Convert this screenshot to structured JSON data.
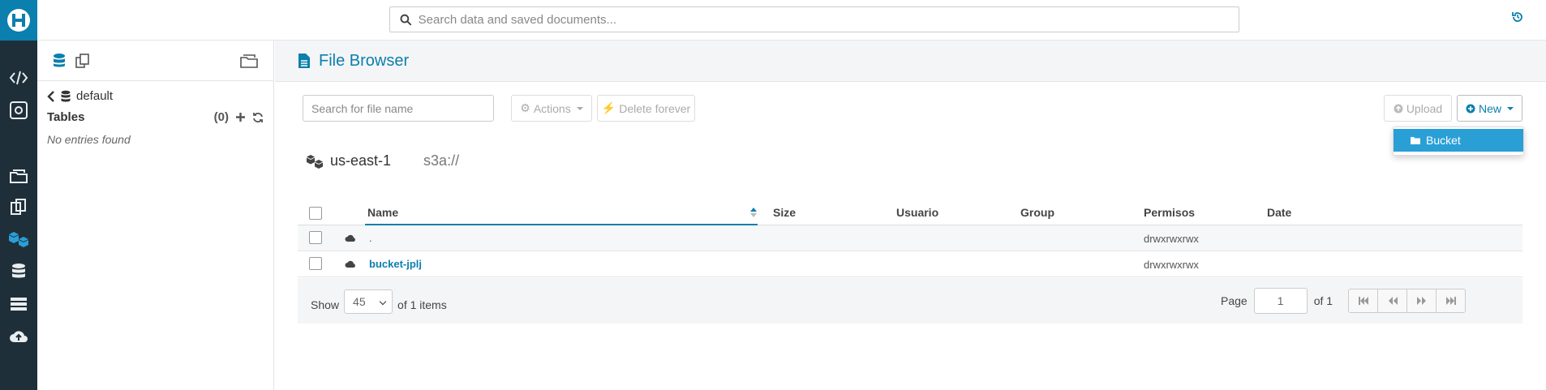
{
  "topbar": {
    "search_placeholder": "Search data and saved documents..."
  },
  "assist": {
    "database": "default",
    "tables_label": "Tables",
    "tables_count": "(0)",
    "no_entries": "No entries found"
  },
  "main": {
    "title": "File Browser",
    "file_search_placeholder": "Search for file name",
    "actions_label": "Actions",
    "delete_label": "Delete forever",
    "upload_label": "Upload",
    "new_label": "New",
    "new_menu": [
      "Bucket"
    ],
    "region": "us-east-1",
    "path": "s3a://",
    "columns": [
      "Name",
      "Size",
      "Usuario",
      "Group",
      "Permisos",
      "Date"
    ],
    "rows": [
      {
        "name": ".",
        "size": "",
        "user": "",
        "group": "",
        "perms": "drwxrwxrwx",
        "date": ""
      },
      {
        "name": "bucket-jplj",
        "size": "",
        "user": "",
        "group": "",
        "perms": "drwxrwxrwx",
        "date": ""
      }
    ],
    "footer": {
      "show_label": "Show",
      "page_size": "45",
      "items_label": "of 1 items",
      "page_label": "Page",
      "page_value": "1",
      "of_label": "of 1"
    }
  },
  "colors": {
    "accent": "#0b7fad",
    "rail": "#1f2f3a",
    "dropdown_active": "#2a9fd6"
  }
}
